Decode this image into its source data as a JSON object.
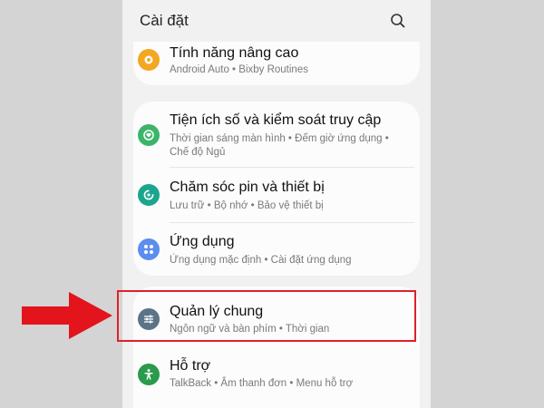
{
  "header": {
    "title": "Cài đặt",
    "search_icon": "search-icon"
  },
  "items": [
    {
      "title": "Tính năng nâng cao",
      "subtitle": "Android Auto  •  Bixby Routines",
      "icon": "gear-star-icon",
      "color": "#f3a722"
    },
    {
      "title": "Tiện ích số và kiểm soát truy cập",
      "subtitle": "Thời gian sáng màn hình  •  Đếm giờ ứng dụng  •",
      "subtitle2": "Chế độ Ngủ",
      "icon": "heart-icon",
      "color": "#3cb56a"
    },
    {
      "title": "Chăm sóc pin và thiết bị",
      "subtitle": "Lưu trữ  •  Bộ nhớ  •  Bảo vệ thiết bị",
      "icon": "refresh-icon",
      "color": "#1aa58e"
    },
    {
      "title": "Ứng dụng",
      "subtitle": "Ứng dụng mặc định  •  Cài đặt ứng dụng",
      "icon": "apps-grid-icon",
      "color": "#5b8ef0"
    },
    {
      "title": "Quản lý chung",
      "subtitle": "Ngôn ngữ và bàn phím  •  Thời gian",
      "icon": "sliders-icon",
      "color": "#5d7386"
    },
    {
      "title": "Hỗ trợ",
      "subtitle": "TalkBack  •  Âm thanh đơn  •  Menu hỗ trợ",
      "icon": "accessibility-icon",
      "color": "#2a9a4c"
    }
  ],
  "annotation": {
    "highlight_color": "#e0202a",
    "arrow_color": "#e3141c"
  }
}
